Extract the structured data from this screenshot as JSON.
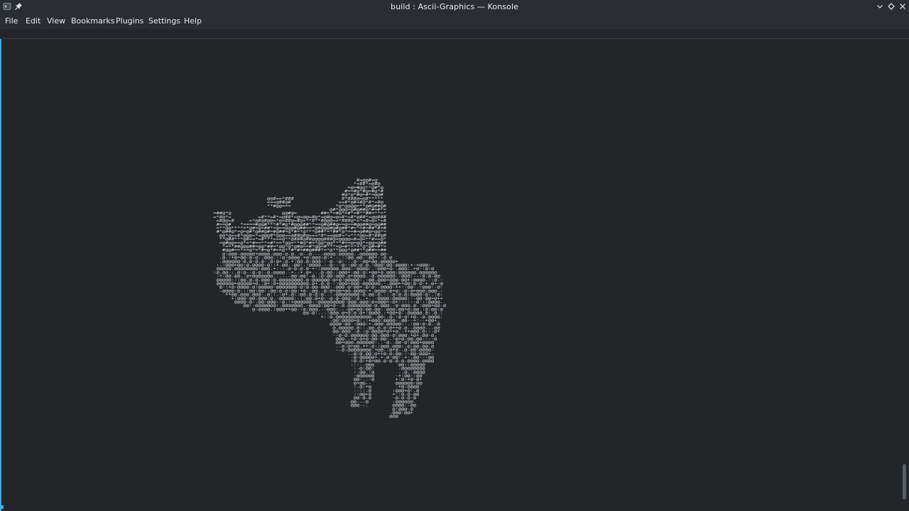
{
  "window": {
    "title": "build : Ascii-Graphics — Konsole",
    "app_icon": "konsole-app-icon",
    "pin_icon": "pin-icon",
    "controls": [
      "minimize-chevron-icon",
      "maximize-diamond-icon",
      "close-x-icon"
    ]
  },
  "menu": {
    "file": "File",
    "edit": "Edit",
    "view": "View",
    "bookmarks": "Bookmarks",
    "plugins": "Plugins",
    "settings": "Settings",
    "help": "Help"
  },
  "terminal": {
    "render_subject": "ascii-rendered 3D horse model",
    "glyph_set": [
      "@",
      "#",
      "=",
      "*",
      "+",
      "-",
      ":",
      "."
    ],
    "scroll_position": 0.98,
    "colors": {
      "background": "#232629",
      "glyph": "#dcdfe2",
      "focus_accent": "#3daee9",
      "chrome": "#2a2e32"
    }
  }
}
